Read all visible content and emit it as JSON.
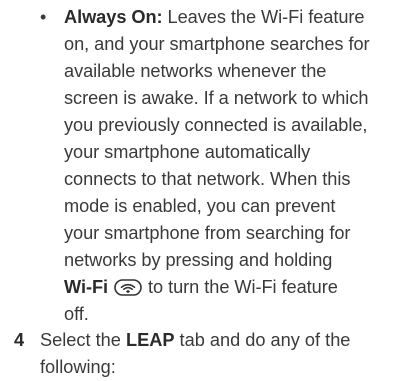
{
  "bullet": {
    "marker": "•",
    "term": "Always On:",
    "line1_rest": " Leaves the Wi-Fi feature",
    "line2": "on, and your smartphone searches for",
    "line3": "available networks whenever the",
    "line4": "screen is awake. If a network to which",
    "line5": "you previously connected is available,",
    "line6": "your smartphone automatically",
    "line7": "connects to that network. When this",
    "line8": "mode is enabled, you can prevent",
    "line9": "your smartphone from searching for",
    "line10": "networks by pressing and holding",
    "wifi_label": "Wi-Fi",
    "wifi_icon": "wifi-icon",
    "line11_rest": "to turn the Wi-Fi feature",
    "line12": "off."
  },
  "step": {
    "number": "4",
    "text_before": "Select the ",
    "tab_name": "LEAP",
    "text_after": " tab and do any of the",
    "line2": "following:"
  }
}
